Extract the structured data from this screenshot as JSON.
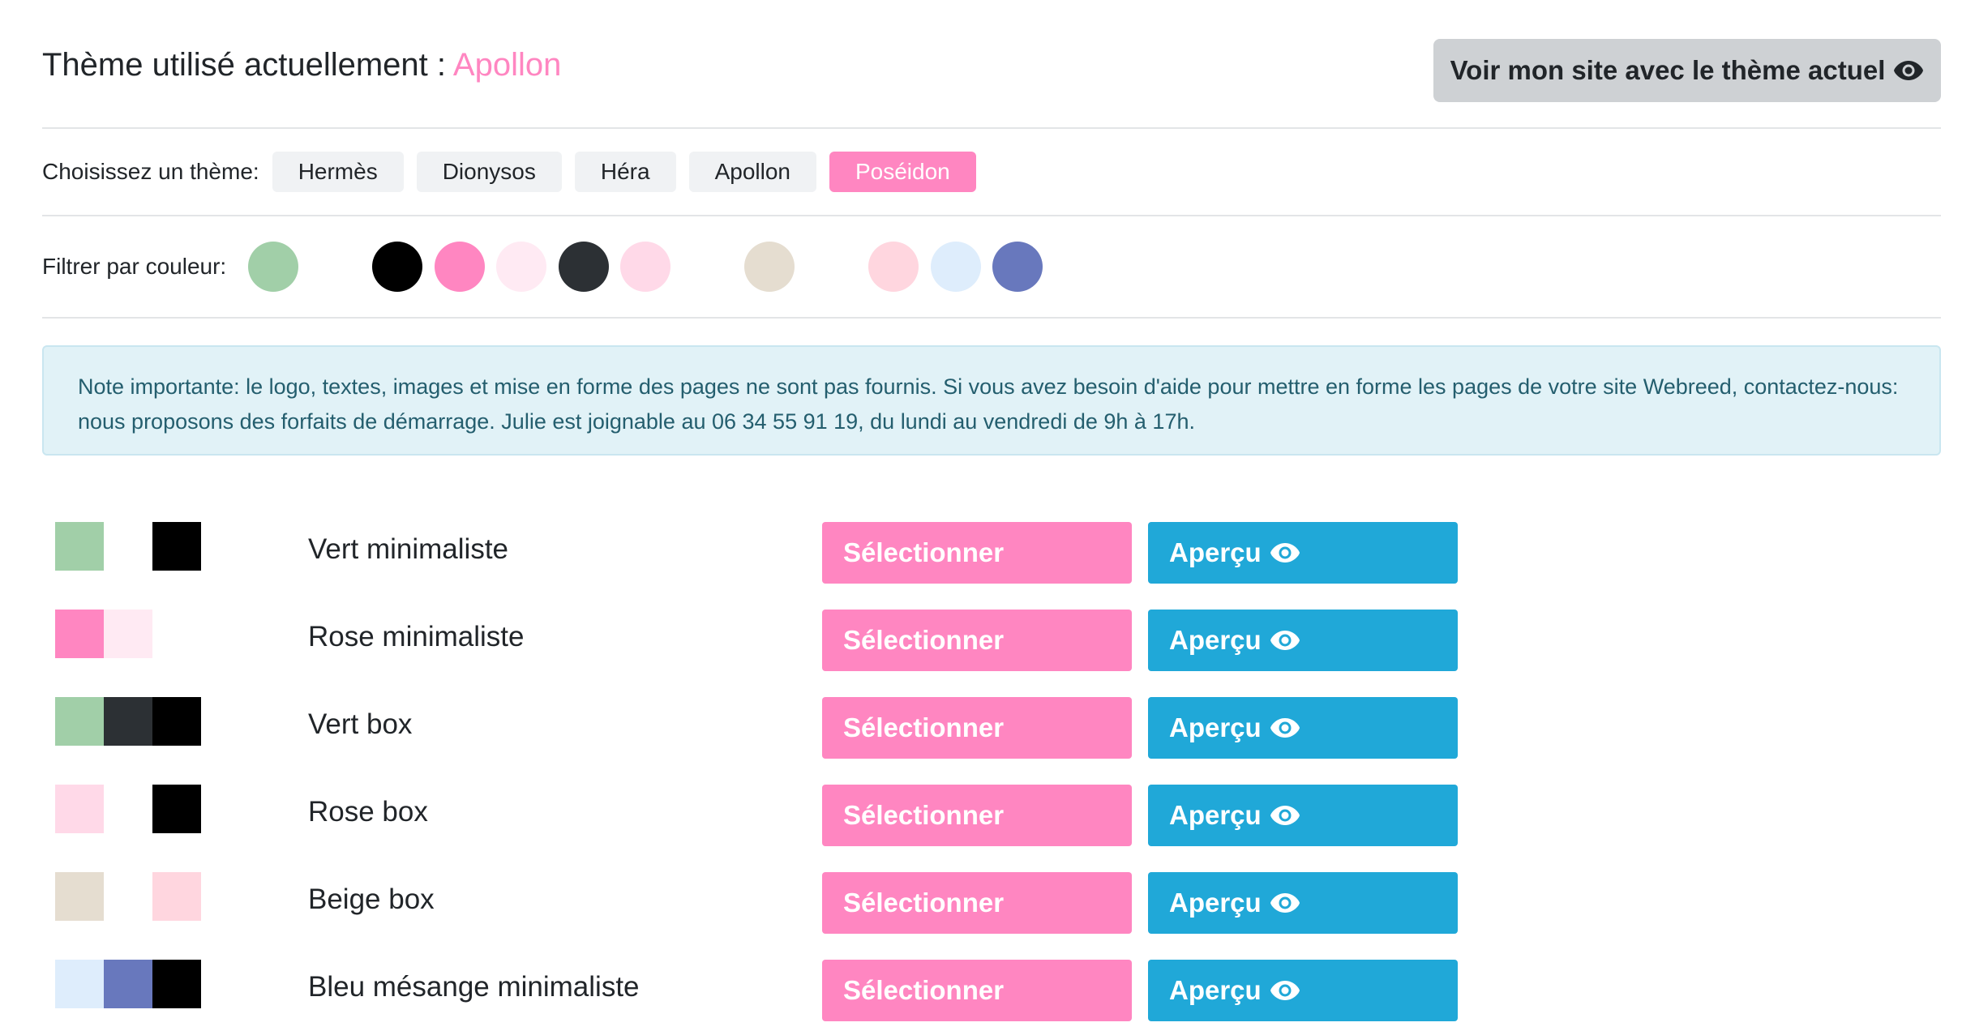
{
  "header": {
    "title_prefix": "Thème utilisé actuellement :",
    "current_theme": "Apollon",
    "view_site_label": "Voir mon site avec le thème actuel",
    "view_site_icon": "eye-icon"
  },
  "theme_picker": {
    "label": "Choisissez un thème:",
    "options": [
      "Hermès",
      "Dionysos",
      "Héra",
      "Apollon",
      "Poséidon"
    ],
    "active": "Poséidon"
  },
  "color_filter": {
    "label": "Filtrer par couleur:",
    "swatches": [
      "#a1cfa8",
      "#ffffff",
      "#000000",
      "#ff86c1",
      "#ffeaf3",
      "#2c3034",
      "#ffd9e8",
      "#ffffff",
      "#e5ddd0",
      "#ffffff",
      "#ffd6df",
      "#deedfc",
      "#6878bd"
    ]
  },
  "note": {
    "text": "Note importante: le logo, textes, images et mise en forme des pages ne sont pas fournis. Si vous avez besoin d'aide pour mettre en forme les pages de votre site Webreed, contactez-nous: nous proposons des forfaits de démarrage. Julie est joignable au 06 34 55 91 19, du lundi au vendredi de 9h à 17h."
  },
  "themes": [
    {
      "name": "Vert minimaliste",
      "colors": [
        "#a1cfa8",
        "#ffffff",
        "#000000"
      ],
      "select_label": "Sélectionner",
      "preview_label": "Aperçu"
    },
    {
      "name": "Rose minimaliste",
      "colors": [
        "#ff86c1",
        "#ffeaf3",
        "#ffffff"
      ],
      "select_label": "Sélectionner",
      "preview_label": "Aperçu"
    },
    {
      "name": "Vert box",
      "colors": [
        "#a1cfa8",
        "#2c3034",
        "#000000"
      ],
      "select_label": "Sélectionner",
      "preview_label": "Aperçu"
    },
    {
      "name": "Rose box",
      "colors": [
        "#ffd9e8",
        "#ffffff",
        "#000000"
      ],
      "select_label": "Sélectionner",
      "preview_label": "Aperçu"
    },
    {
      "name": "Beige box",
      "colors": [
        "#e5ddd0",
        "#ffffff",
        "#ffd6df"
      ],
      "select_label": "Sélectionner",
      "preview_label": "Aperçu"
    },
    {
      "name": "Bleu mésange minimaliste",
      "colors": [
        "#deedfc",
        "#6878bd",
        "#000000"
      ],
      "select_label": "Sélectionner",
      "preview_label": "Aperçu"
    }
  ],
  "colors": {
    "accent_pink": "#ff86c1",
    "preview_blue": "#20a8d8",
    "note_bg": "#e1f2f7",
    "note_text": "#245e6e"
  }
}
